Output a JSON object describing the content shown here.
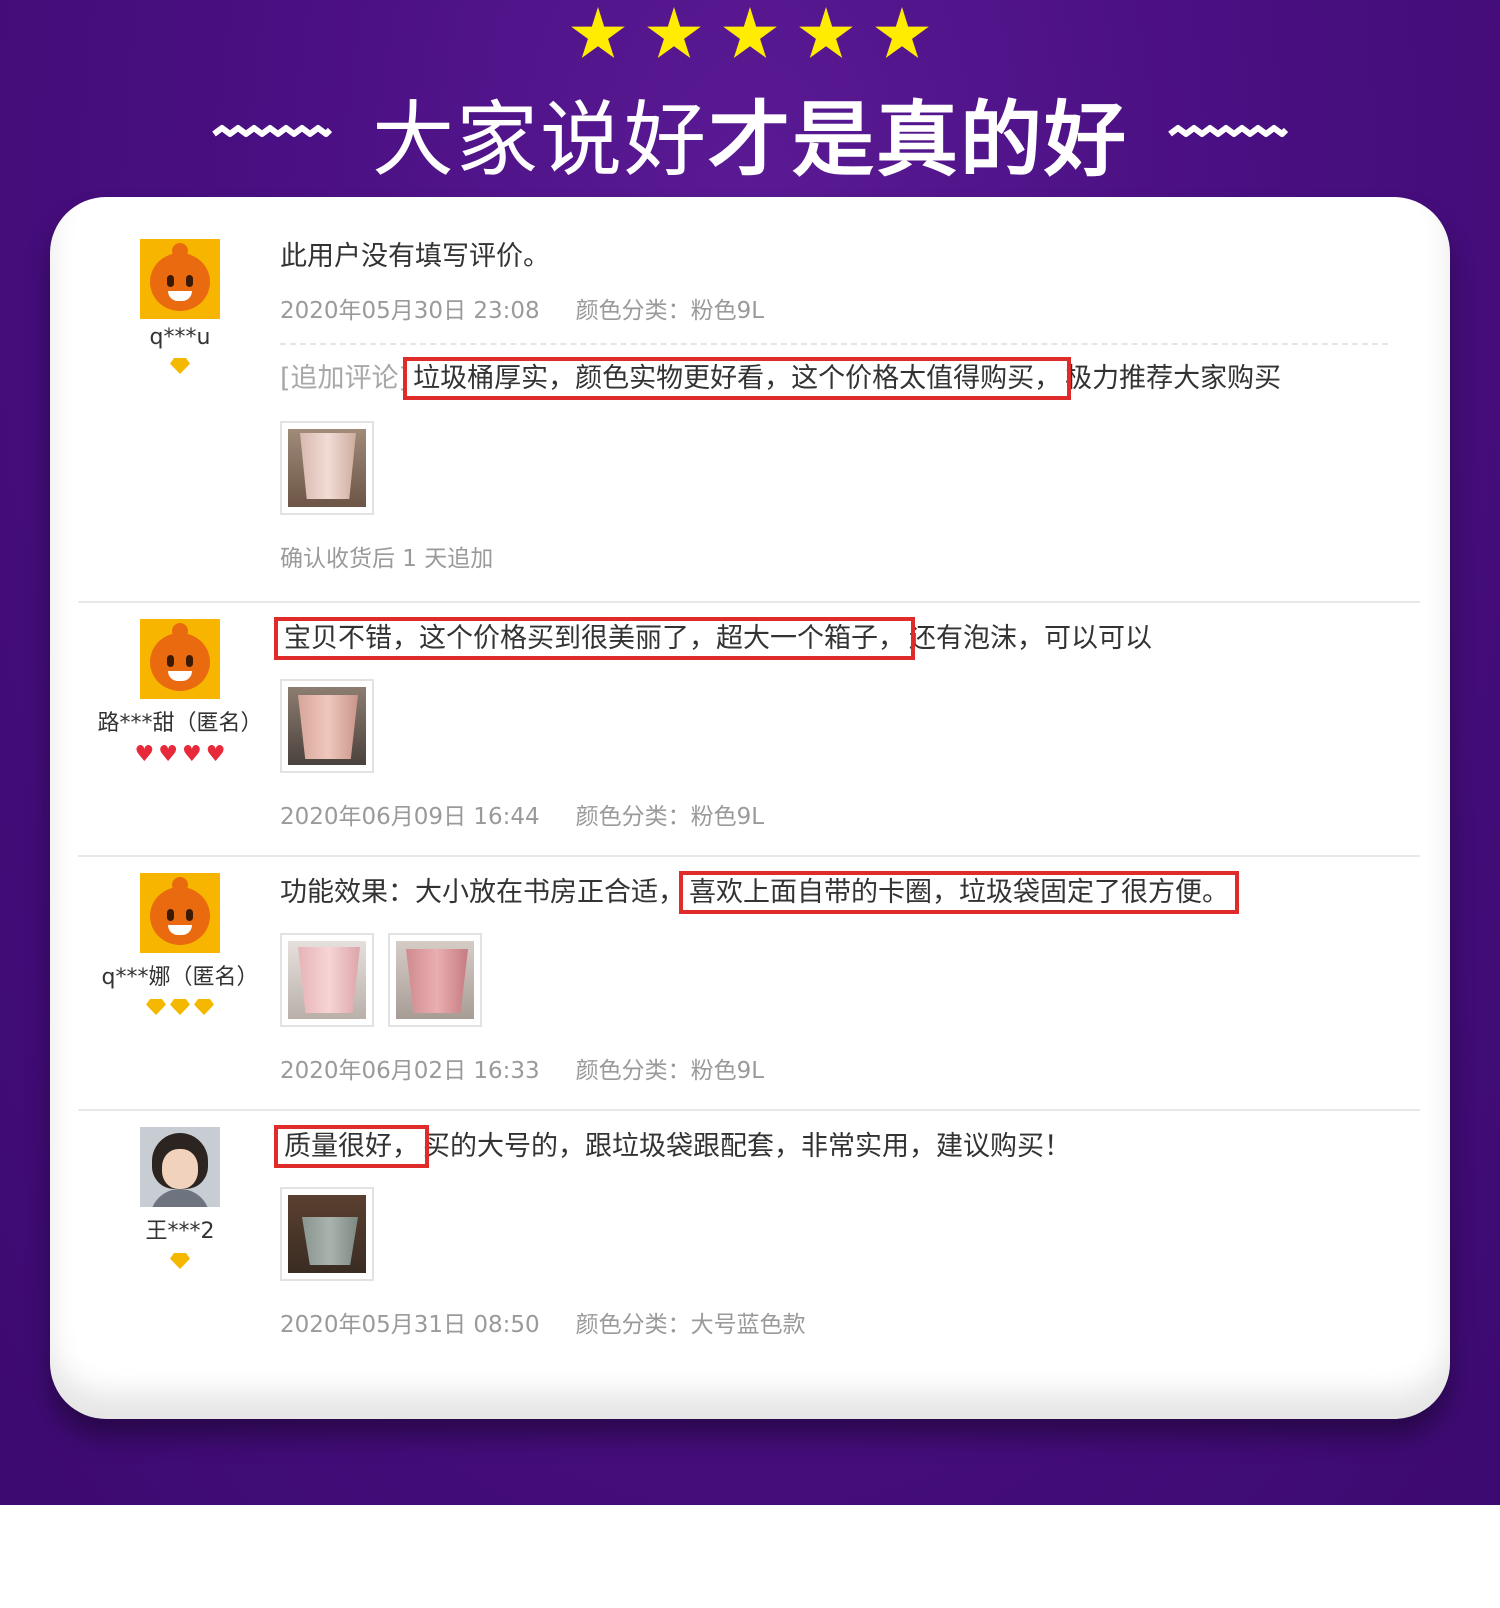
{
  "header": {
    "stars": 5,
    "title_light": "大家说好",
    "title_bold": "才是真的好",
    "star_color": "#ffec00",
    "background_color": "#4a0f82"
  },
  "reviews": [
    {
      "user": "q***u",
      "avatar_icon": "taobao-default-avatar",
      "badge_icon": "gem-icon",
      "badge_count": 1,
      "text": "此用户没有填写评价。",
      "date": "2020年05月30日 23:08",
      "category": "颜色分类：粉色9L",
      "followup_prefix": "[追加评论]",
      "followup_highlight": "垃圾桶厚实，颜色实物更好看，这个价格太值得购买，",
      "followup_rest": "极力推荐大家购买",
      "followup_note": "确认收货后 1 天追加"
    },
    {
      "user": "路***甜（匿名）",
      "avatar_icon": "taobao-default-avatar",
      "badge_icon": "heart-icon",
      "badge_count": 4,
      "text_highlight": "宝贝不错，这个价格买到很美丽了，超大一个箱子，",
      "text_rest": "还有泡沫，可以可以",
      "date": "2020年06月09日 16:44",
      "category": "颜色分类：粉色9L"
    },
    {
      "user": "q***娜（匿名）",
      "avatar_icon": "taobao-default-avatar",
      "badge_icon": "gem-icon",
      "badge_count": 3,
      "text_prefix": "功能效果：大小放在书房正合适，",
      "text_highlight": "喜欢上面自带的卡圈，垃圾袋固定了很方便。",
      "date": "2020年06月02日 16:33",
      "category": "颜色分类：粉色9L"
    },
    {
      "user": "王***2",
      "avatar_icon": "child-photo-avatar",
      "badge_icon": "gem-icon",
      "badge_count": 1,
      "text_highlight": "质量很好，",
      "text_rest": "买的大号的，跟垃圾袋跟配套，非常实用，建议购买！",
      "date": "2020年05月31日 08:50",
      "category": "颜色分类：大号蓝色款"
    }
  ],
  "highlight_color": "#e02b2b"
}
